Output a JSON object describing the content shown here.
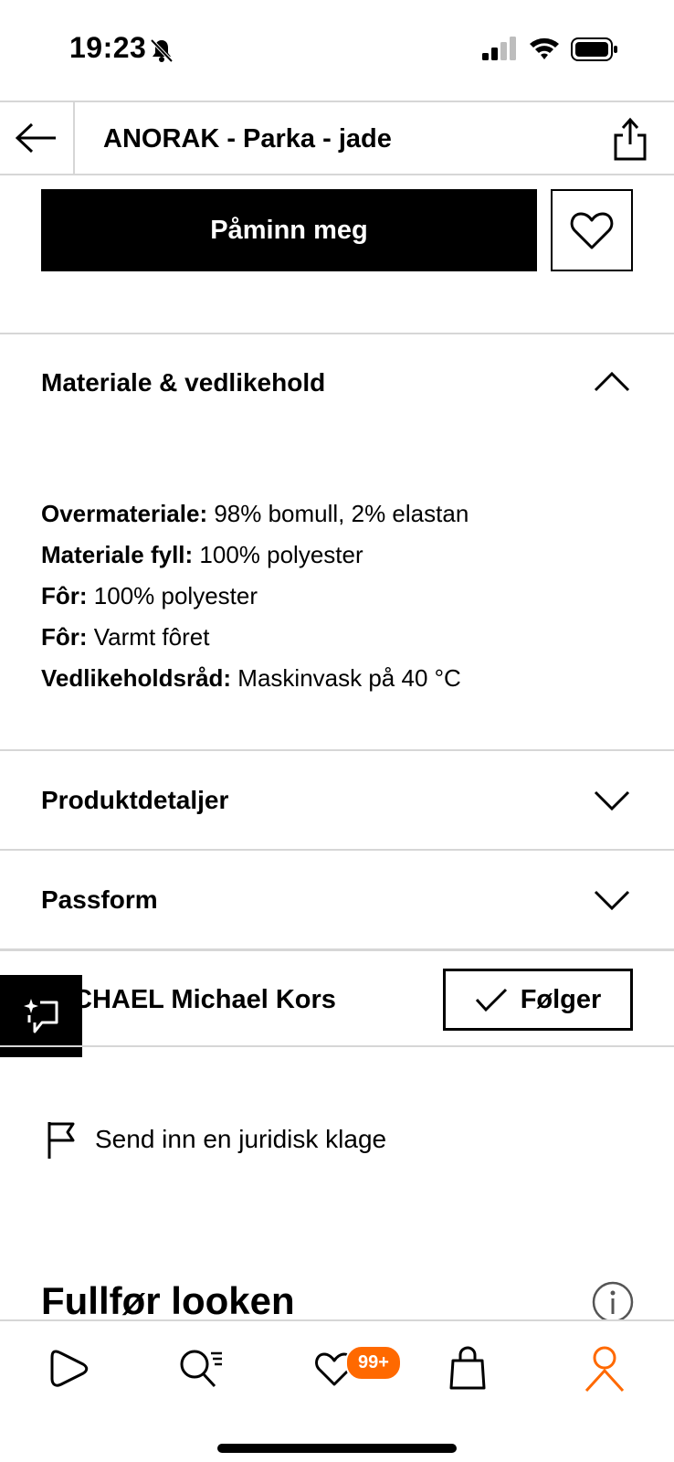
{
  "status_bar": {
    "time": "19:23"
  },
  "header": {
    "title": "ANORAK - Parka - jade"
  },
  "cta": {
    "remind_label": "Påminn meg"
  },
  "sections": {
    "material": {
      "title": "Materiale & vedlikehold",
      "rows": [
        {
          "label": "Overmateriale:",
          "value": " 98% bomull, 2% elastan"
        },
        {
          "label": "Materiale fyll:",
          "value": " 100% polyester"
        },
        {
          "label": "Fôr:",
          "value": " 100% polyester"
        },
        {
          "label": "Fôr:",
          "value": " Varmt fôret"
        },
        {
          "label": "Vedlikeholdsråd:",
          "value": " Maskinvask på 40 °C"
        }
      ]
    },
    "details": {
      "title": "Produktdetaljer"
    },
    "fit": {
      "title": "Passform"
    }
  },
  "brand": {
    "name": "CHAEL Michael Kors",
    "follow_label": "Følger"
  },
  "complaint": {
    "label": "Send inn en juridisk klage"
  },
  "complete_look": {
    "title": "Fullfør looken"
  },
  "nav": {
    "wishlist_badge": "99+",
    "accent": "#ff6900"
  }
}
